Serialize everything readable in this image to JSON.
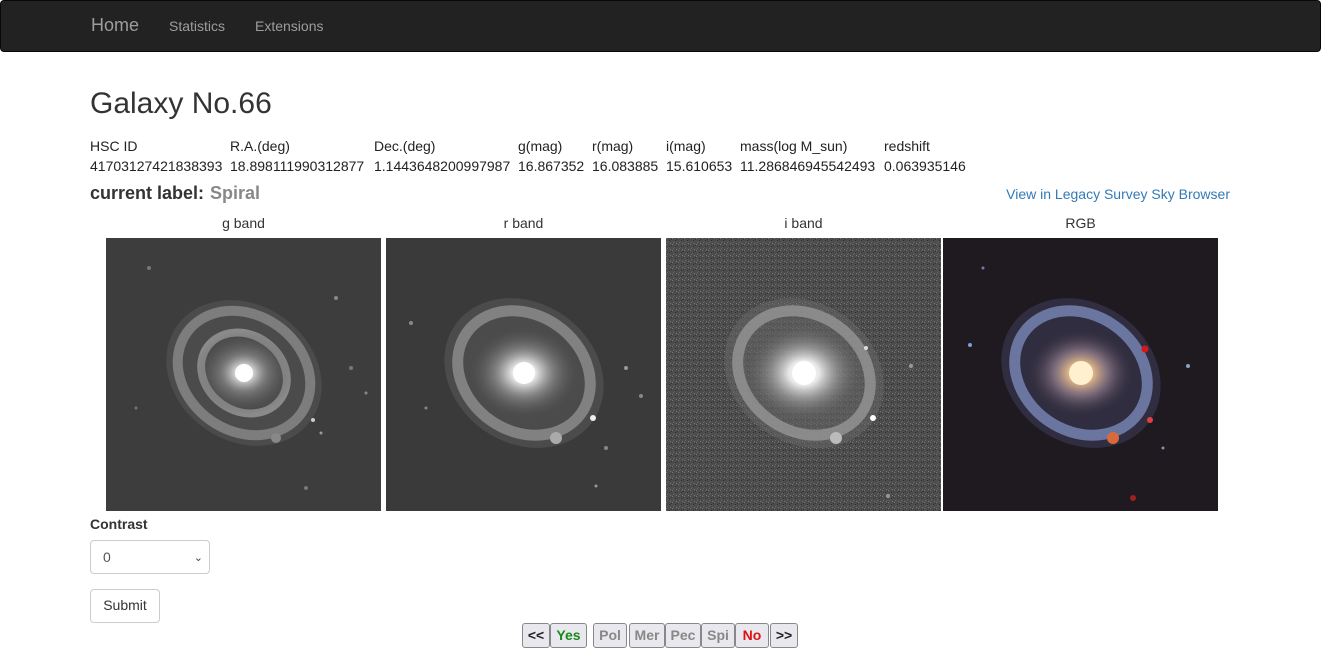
{
  "nav": {
    "brand": "Home",
    "links": [
      "Statistics",
      "Extensions"
    ]
  },
  "title": "Galaxy No.66",
  "meta": {
    "columns": [
      {
        "header": "HSC ID",
        "value": "41703127421838393"
      },
      {
        "header": "R.A.(deg)",
        "value": "18.898111990312877"
      },
      {
        "header": "Dec.(deg)",
        "value": "1.1443648200997987"
      },
      {
        "header": "g(mag)",
        "value": "16.867352"
      },
      {
        "header": "r(mag)",
        "value": "16.083885"
      },
      {
        "header": "i(mag)",
        "value": "15.610653"
      },
      {
        "header": "mass(log M_sun)",
        "value": "11.286846945542493"
      },
      {
        "header": "redshift",
        "value": "0.063935146"
      }
    ]
  },
  "label": {
    "caption": "current label:",
    "value": "Spiral"
  },
  "legacy_link": "View in Legacy Survey Sky Browser",
  "bands": [
    "g band",
    "r band",
    "i band",
    "RGB"
  ],
  "contrast": {
    "label": "Contrast",
    "selected": "0"
  },
  "submit_label": "Submit",
  "pager": {
    "buttons": [
      {
        "label": "<<",
        "color": "#222222"
      },
      {
        "label": "Yes",
        "color": "#1a8a1a"
      },
      {
        "label": "Pol",
        "color": "#888888"
      },
      {
        "label": "Mer",
        "color": "#888888"
      },
      {
        "label": "Pec",
        "color": "#888888"
      },
      {
        "label": "Spi",
        "color": "#888888"
      },
      {
        "label": "No",
        "color": "#e01010"
      },
      {
        "label": ">>",
        "color": "#222222"
      }
    ]
  }
}
